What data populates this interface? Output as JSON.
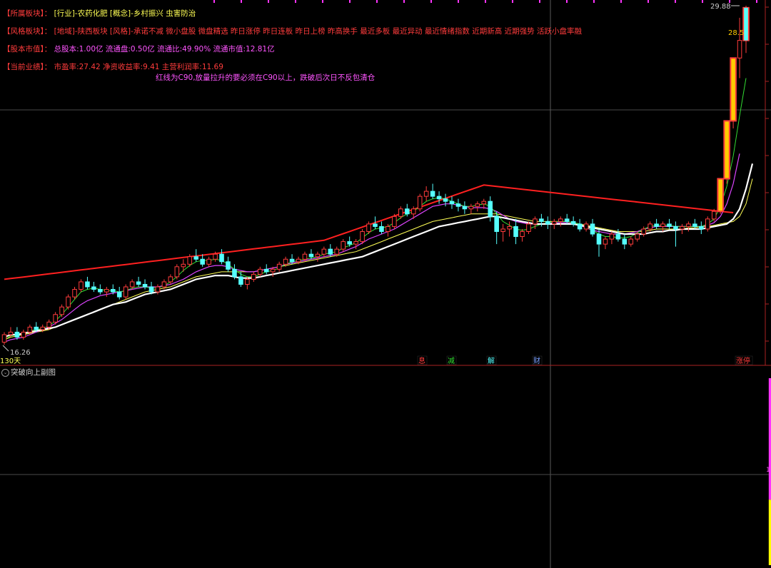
{
  "header": {
    "sector_label": "【所属板块】：",
    "sector_value": "[行业]-农药化肥 [概念]-乡村振兴 虫害防治",
    "style_label": "【风格板块】：",
    "style_value": "[地域]-陕西板块 [风格]-承诺不减 微小盘股 微盘精选 昨日涨停 昨日连板 昨日上榜 昨高换手 最近多板 最近异动 最近情绪指数 近期新高 近期强势 活跃小盘率融",
    "capital_label": "【股本市值】：",
    "capital_value": "总股本:1.00亿 流通盘:0.50亿 流通比:49.90% 流通市值:12.81亿",
    "perf_label": "【当前业绩】：",
    "perf_value": "市盈率:27.42 净资收益率:9.41 主营利润率:11.69",
    "note": "红线为C90,放量拉升的要必须在C90以上，跌破后次日不反包清仓"
  },
  "price_labels": {
    "high": "29.88",
    "latest_high": "28.5",
    "low": "16.26",
    "period": "130天"
  },
  "event_tags": [
    {
      "label": "息",
      "color": "#ff3c3c"
    },
    {
      "label": "减",
      "color": "#33dd33"
    },
    {
      "label": "解",
      "color": "#55ffff"
    },
    {
      "label": "财",
      "color": "#7aa0ff"
    },
    {
      "label": "涨停",
      "color": "#ff3c3c"
    }
  ],
  "sub_panel": {
    "title": "突破向上副图",
    "axis_mark": "1"
  },
  "colors": {
    "up": "#ff3c3c",
    "down": "#55ffff",
    "ma_white": "#ffffff",
    "ma_yellow": "#ffff55",
    "ma_magenta": "#dd44ff",
    "ma_green": "#33dd33",
    "c90": "#ff2020",
    "sub_magenta": "#ff33ff",
    "sub_yellow": "#ffff00"
  },
  "chart_data": {
    "type": "candlestick",
    "ylim": [
      16.26,
      29.88
    ],
    "c90_start": 19.0,
    "c90_kink_index": 50,
    "candles": [
      [
        16.5,
        16.9,
        16.4,
        16.8
      ],
      [
        16.8,
        17.1,
        16.7,
        16.9
      ],
      [
        16.9,
        17.1,
        16.6,
        16.7
      ],
      [
        16.7,
        17.0,
        16.6,
        16.9
      ],
      [
        16.9,
        17.2,
        16.8,
        17.1
      ],
      [
        17.1,
        17.3,
        16.9,
        17.0
      ],
      [
        17.0,
        17.2,
        16.9,
        17.1
      ],
      [
        17.1,
        17.4,
        17.0,
        17.3
      ],
      [
        17.3,
        17.7,
        17.2,
        17.6
      ],
      [
        17.6,
        18.0,
        17.5,
        17.9
      ],
      [
        17.9,
        18.4,
        17.8,
        18.3
      ],
      [
        18.3,
        18.7,
        18.2,
        18.6
      ],
      [
        18.6,
        19.0,
        18.5,
        18.9
      ],
      [
        18.9,
        19.1,
        18.6,
        18.7
      ],
      [
        18.7,
        18.9,
        18.5,
        18.6
      ],
      [
        18.6,
        18.8,
        18.4,
        18.5
      ],
      [
        18.5,
        18.7,
        18.3,
        18.6
      ],
      [
        18.6,
        18.8,
        18.4,
        18.5
      ],
      [
        18.5,
        18.7,
        18.2,
        18.3
      ],
      [
        18.3,
        18.8,
        18.2,
        18.7
      ],
      [
        18.7,
        19.0,
        18.6,
        18.9
      ],
      [
        18.9,
        19.1,
        18.7,
        18.8
      ],
      [
        18.8,
        19.0,
        18.6,
        18.7
      ],
      [
        18.7,
        18.9,
        18.4,
        18.5
      ],
      [
        18.5,
        18.8,
        18.4,
        18.7
      ],
      [
        18.7,
        19.0,
        18.6,
        18.9
      ],
      [
        18.9,
        19.2,
        18.8,
        19.1
      ],
      [
        19.1,
        19.6,
        19.0,
        19.5
      ],
      [
        19.5,
        19.8,
        19.3,
        19.6
      ],
      [
        19.6,
        20.0,
        19.5,
        19.9
      ],
      [
        19.9,
        20.2,
        19.7,
        19.8
      ],
      [
        19.8,
        20.0,
        19.5,
        19.6
      ],
      [
        19.6,
        19.9,
        19.5,
        19.8
      ],
      [
        19.8,
        20.1,
        19.7,
        20.0
      ],
      [
        20.0,
        20.2,
        19.6,
        19.7
      ],
      [
        19.7,
        19.9,
        19.3,
        19.4
      ],
      [
        19.4,
        19.6,
        19.0,
        19.1
      ],
      [
        19.1,
        19.3,
        18.7,
        18.8
      ],
      [
        18.8,
        19.1,
        18.6,
        19.0
      ],
      [
        19.0,
        19.3,
        18.9,
        19.2
      ],
      [
        19.2,
        19.5,
        19.1,
        19.4
      ],
      [
        19.4,
        19.6,
        19.2,
        19.3
      ],
      [
        19.3,
        19.5,
        19.1,
        19.4
      ],
      [
        19.4,
        19.7,
        19.3,
        19.6
      ],
      [
        19.6,
        19.9,
        19.5,
        19.8
      ],
      [
        19.8,
        20.0,
        19.6,
        19.7
      ],
      [
        19.7,
        19.9,
        19.6,
        19.8
      ],
      [
        19.8,
        20.1,
        19.7,
        20.0
      ],
      [
        20.0,
        20.2,
        19.8,
        19.9
      ],
      [
        19.9,
        20.1,
        19.7,
        20.0
      ],
      [
        20.0,
        20.3,
        19.9,
        20.2
      ],
      [
        20.2,
        20.4,
        19.9,
        20.0
      ],
      [
        20.0,
        20.3,
        19.9,
        20.2
      ],
      [
        20.2,
        20.6,
        20.1,
        20.5
      ],
      [
        20.5,
        20.7,
        20.3,
        20.4
      ],
      [
        20.4,
        20.6,
        20.2,
        20.5
      ],
      [
        20.5,
        21.0,
        20.4,
        20.9
      ],
      [
        20.9,
        21.3,
        20.8,
        21.2
      ],
      [
        21.2,
        21.5,
        21.0,
        21.1
      ],
      [
        21.1,
        21.3,
        20.8,
        20.9
      ],
      [
        20.9,
        21.2,
        20.7,
        21.1
      ],
      [
        21.1,
        21.6,
        21.0,
        21.5
      ],
      [
        21.5,
        21.9,
        21.4,
        21.8
      ],
      [
        21.8,
        22.0,
        21.5,
        21.6
      ],
      [
        21.6,
        21.9,
        21.4,
        21.8
      ],
      [
        21.8,
        22.4,
        21.7,
        22.3
      ],
      [
        22.3,
        22.7,
        22.1,
        22.5
      ],
      [
        22.5,
        22.8,
        22.2,
        22.3
      ],
      [
        22.3,
        22.5,
        22.0,
        22.2
      ],
      [
        22.2,
        22.4,
        21.9,
        22.1
      ],
      [
        22.1,
        22.3,
        21.8,
        22.0
      ],
      [
        22.0,
        22.2,
        21.7,
        21.9
      ],
      [
        21.9,
        22.1,
        21.6,
        21.8
      ],
      [
        21.8,
        22.0,
        21.6,
        21.9
      ],
      [
        21.9,
        22.1,
        21.7,
        22.0
      ],
      [
        22.0,
        22.2,
        21.8,
        22.1
      ],
      [
        22.1,
        22.3,
        21.3,
        21.5
      ],
      [
        21.5,
        21.7,
        20.4,
        20.9
      ],
      [
        20.9,
        21.2,
        20.5,
        21.0
      ],
      [
        21.0,
        21.3,
        20.7,
        21.1
      ],
      [
        21.1,
        21.4,
        20.4,
        20.7
      ],
      [
        20.7,
        21.0,
        20.5,
        20.9
      ],
      [
        20.9,
        21.3,
        20.8,
        21.2
      ],
      [
        21.2,
        21.5,
        21.0,
        21.4
      ],
      [
        21.4,
        21.6,
        21.1,
        21.3
      ],
      [
        21.3,
        21.5,
        21.0,
        21.2
      ],
      [
        21.2,
        21.4,
        21.0,
        21.3
      ],
      [
        21.3,
        21.5,
        21.1,
        21.4
      ],
      [
        21.4,
        21.6,
        21.2,
        21.3
      ],
      [
        21.3,
        21.5,
        21.1,
        21.2
      ],
      [
        21.2,
        21.4,
        20.9,
        21.0
      ],
      [
        21.0,
        21.3,
        20.9,
        21.2
      ],
      [
        21.2,
        21.4,
        20.7,
        20.8
      ],
      [
        20.8,
        21.0,
        19.9,
        20.4
      ],
      [
        20.4,
        20.7,
        20.2,
        20.6
      ],
      [
        20.6,
        20.9,
        20.4,
        20.8
      ],
      [
        20.8,
        21.0,
        20.5,
        20.6
      ],
      [
        20.6,
        20.8,
        20.2,
        20.4
      ],
      [
        20.4,
        20.7,
        20.3,
        20.6
      ],
      [
        20.6,
        20.9,
        20.5,
        20.8
      ],
      [
        20.8,
        21.1,
        20.7,
        21.0
      ],
      [
        21.0,
        21.3,
        20.9,
        21.2
      ],
      [
        21.2,
        21.4,
        21.0,
        21.1
      ],
      [
        21.1,
        21.3,
        20.9,
        21.2
      ],
      [
        21.2,
        21.4,
        21.0,
        21.1
      ],
      [
        21.1,
        21.3,
        20.3,
        21.0
      ],
      [
        21.0,
        21.2,
        20.8,
        21.1
      ],
      [
        21.1,
        21.3,
        20.9,
        21.2
      ],
      [
        21.2,
        21.4,
        21.0,
        21.1
      ],
      [
        21.1,
        21.3,
        20.8,
        21.0
      ],
      [
        21.0,
        21.5,
        20.9,
        21.4
      ],
      [
        21.4,
        21.8,
        21.3,
        21.7
      ],
      [
        21.7,
        23.0,
        21.6,
        23.0
      ],
      [
        23.0,
        25.3,
        22.8,
        25.3
      ],
      [
        25.3,
        27.8,
        25.0,
        27.8
      ],
      [
        27.8,
        29.4,
        27.0,
        28.5
      ],
      [
        28.5,
        29.88,
        28.0,
        29.8
      ]
    ],
    "ma_white": [
      16.7,
      16.8,
      16.8,
      16.85,
      16.9,
      16.95,
      17.0,
      17.05,
      17.1,
      17.2,
      17.3,
      17.4,
      17.5,
      17.6,
      17.7,
      17.8,
      17.9,
      18.0,
      18.05,
      18.1,
      18.2,
      18.3,
      18.4,
      18.45,
      18.5,
      18.55,
      18.6,
      18.7,
      18.8,
      18.9,
      19.0,
      19.05,
      19.1,
      19.15,
      19.15,
      19.15,
      19.1,
      19.05,
      19.05,
      19.05,
      19.1,
      19.15,
      19.2,
      19.25,
      19.3,
      19.35,
      19.4,
      19.45,
      19.5,
      19.55,
      19.6,
      19.65,
      19.7,
      19.75,
      19.8,
      19.85,
      19.9,
      20.0,
      20.1,
      20.2,
      20.3,
      20.4,
      20.5,
      20.6,
      20.7,
      20.8,
      20.9,
      21.0,
      21.1,
      21.15,
      21.2,
      21.25,
      21.3,
      21.35,
      21.4,
      21.45,
      21.5,
      21.5,
      21.45,
      21.4,
      21.35,
      21.3,
      21.25,
      21.2,
      21.2,
      21.2,
      21.2,
      21.2,
      21.2,
      21.2,
      21.15,
      21.1,
      21.05,
      21.0,
      20.95,
      20.9,
      20.85,
      20.8,
      20.8,
      20.8,
      20.8,
      20.85,
      20.9,
      20.9,
      20.95,
      20.95,
      21.0,
      21.0,
      21.0,
      21.0,
      21.05,
      21.1,
      21.15,
      21.2,
      21.4,
      21.8,
      22.6,
      23.6
    ],
    "ma_yellow": [
      16.6,
      16.7,
      16.75,
      16.8,
      16.85,
      16.9,
      16.95,
      17.0,
      17.1,
      17.2,
      17.3,
      17.4,
      17.5,
      17.6,
      17.7,
      17.8,
      17.9,
      18.0,
      18.1,
      18.2,
      18.3,
      18.4,
      18.5,
      18.55,
      18.6,
      18.65,
      18.7,
      18.8,
      18.9,
      19.0,
      19.1,
      19.15,
      19.2,
      19.25,
      19.3,
      19.3,
      19.3,
      19.3,
      19.3,
      19.3,
      19.35,
      19.4,
      19.45,
      19.5,
      19.55,
      19.6,
      19.65,
      19.7,
      19.75,
      19.8,
      19.85,
      19.9,
      19.95,
      20.0,
      20.05,
      20.1,
      20.2,
      20.3,
      20.4,
      20.5,
      20.6,
      20.7,
      20.8,
      20.9,
      21.0,
      21.1,
      21.2,
      21.3,
      21.35,
      21.4,
      21.45,
      21.5,
      21.55,
      21.6,
      21.6,
      21.6,
      21.6,
      21.6,
      21.55,
      21.5,
      21.45,
      21.4,
      21.35,
      21.3,
      21.3,
      21.3,
      21.3,
      21.3,
      21.3,
      21.25,
      21.2,
      21.15,
      21.1,
      21.05,
      21.0,
      20.95,
      20.9,
      20.9,
      20.9,
      20.9,
      20.9,
      20.95,
      21.0,
      21.0,
      21.0,
      21.0,
      21.0,
      21.05,
      21.05,
      21.1,
      21.1,
      21.15,
      21.2,
      21.25,
      21.3,
      21.5,
      22.0,
      23.0
    ],
    "ma_magenta": [
      16.5,
      16.6,
      16.65,
      16.7,
      16.8,
      16.9,
      17.0,
      17.1,
      17.25,
      17.4,
      17.6,
      17.8,
      18.0,
      18.15,
      18.25,
      18.35,
      18.4,
      18.45,
      18.5,
      18.55,
      18.6,
      18.65,
      18.7,
      18.7,
      18.7,
      18.75,
      18.8,
      18.9,
      19.0,
      19.15,
      19.3,
      19.4,
      19.5,
      19.55,
      19.55,
      19.5,
      19.4,
      19.35,
      19.3,
      19.3,
      19.35,
      19.4,
      19.45,
      19.5,
      19.6,
      19.65,
      19.7,
      19.75,
      19.8,
      19.85,
      19.9,
      19.95,
      20.0,
      20.1,
      20.2,
      20.3,
      20.45,
      20.6,
      20.7,
      20.8,
      20.9,
      21.0,
      21.15,
      21.3,
      21.45,
      21.6,
      21.75,
      21.9,
      21.95,
      22.0,
      22.0,
      21.95,
      21.9,
      21.85,
      21.85,
      21.85,
      21.8,
      21.7,
      21.55,
      21.4,
      21.3,
      21.25,
      21.2,
      21.2,
      21.2,
      21.2,
      21.25,
      21.25,
      21.25,
      21.2,
      21.15,
      21.05,
      20.95,
      20.9,
      20.85,
      20.8,
      20.8,
      20.8,
      20.85,
      20.9,
      21.0,
      21.05,
      21.1,
      21.1,
      21.1,
      21.1,
      21.1,
      21.1,
      21.1,
      21.1,
      21.15,
      21.25,
      21.5,
      22.0,
      22.8,
      24.0
    ],
    "ma_green": [
      16.6,
      16.75,
      16.8,
      16.85,
      16.95,
      17.0,
      17.05,
      17.15,
      17.35,
      17.6,
      17.9,
      18.2,
      18.5,
      18.6,
      18.65,
      18.6,
      18.55,
      18.55,
      18.5,
      18.55,
      18.65,
      18.7,
      18.7,
      18.65,
      18.65,
      18.75,
      18.9,
      19.1,
      19.35,
      19.55,
      19.7,
      19.75,
      19.75,
      19.8,
      19.75,
      19.6,
      19.4,
      19.2,
      19.1,
      19.1,
      19.2,
      19.3,
      19.35,
      19.45,
      19.6,
      19.7,
      19.75,
      19.8,
      19.85,
      19.9,
      20.0,
      20.05,
      20.1,
      20.25,
      20.35,
      20.45,
      20.65,
      20.85,
      21.0,
      21.05,
      21.1,
      21.25,
      21.45,
      21.6,
      21.7,
      21.9,
      22.1,
      22.2,
      22.25,
      22.2,
      22.1,
      22.0,
      21.9,
      21.9,
      21.95,
      22.0,
      21.9,
      21.6,
      21.3,
      21.15,
      21.0,
      20.95,
      21.0,
      21.1,
      21.2,
      21.25,
      21.3,
      21.3,
      21.3,
      21.25,
      21.2,
      21.1,
      20.95,
      20.8,
      20.7,
      20.7,
      20.65,
      20.65,
      20.7,
      20.85,
      21.0,
      21.1,
      21.15,
      21.15,
      21.15,
      21.1,
      21.1,
      21.1,
      21.1,
      21.1,
      21.2,
      21.4,
      21.9,
      22.7,
      23.9,
      25.5,
      27.0
    ],
    "sub_bar": {
      "index": 120,
      "yellow_value": 0.35,
      "magenta_value": 0.65
    }
  }
}
